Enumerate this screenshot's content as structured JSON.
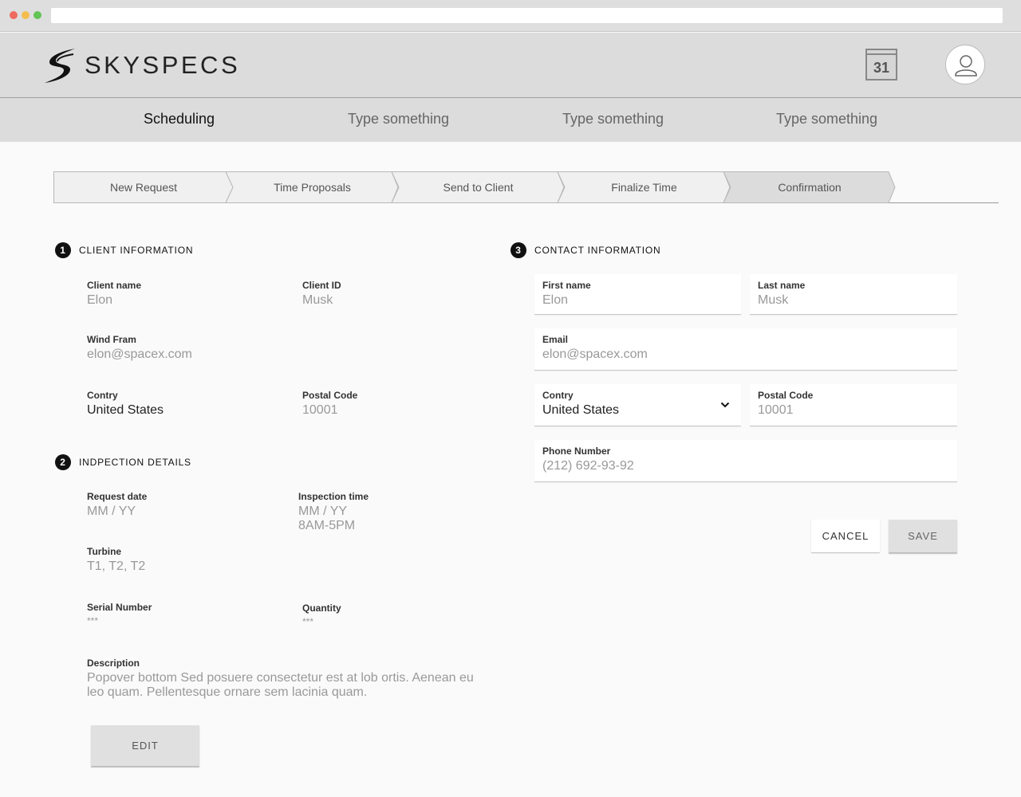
{
  "app": {
    "brand": "SKYSPECS"
  },
  "header": {
    "calendar_day": "31",
    "nav": [
      {
        "label": "Scheduling",
        "active": true
      },
      {
        "label": "Type something",
        "active": false
      },
      {
        "label": "Type something",
        "active": false
      },
      {
        "label": "Type something",
        "active": false
      }
    ]
  },
  "stepper": {
    "steps": [
      "New Request",
      "Time Proposals",
      "Send to Client",
      "Finalize Time",
      "Confirmation"
    ],
    "current_index": 4
  },
  "client_info": {
    "number": "1",
    "title": "CLIENT INFORMATION",
    "client_name_label": "Client name",
    "client_name_value": "Elon",
    "client_id_label": "Client ID",
    "client_id_value": "Musk",
    "wind_farm_label": "Wind Fram",
    "wind_farm_value": "elon@spacex.com",
    "country_label": "Contry",
    "country_value": "United States",
    "postal_label": "Postal Code",
    "postal_value": "10001"
  },
  "inspection": {
    "number": "2",
    "title": "INDPECTION DETAILS",
    "request_date_label": "Request date",
    "request_date_value": "MM / YY",
    "inspection_time_label": "Inspection time",
    "inspection_time_value1": "MM / YY",
    "inspection_time_value2": "8AM-5PM",
    "turbine_label": "Turbine",
    "turbine_value": "T1, T2, T2",
    "serial_label": "Serial Number",
    "serial_value": "***",
    "quantity_label": "Quantity",
    "quantity_value": "***",
    "description_label": "Description",
    "description_line1": "Popover bottom Sed posuere consectetur est at lob ortis. Aenean eu",
    "description_line2": "leo quam. Pellentesque ornare sem lacinia quam.",
    "edit_label": "EDIT"
  },
  "contact": {
    "number": "3",
    "title": "CONTACT INFORMATION",
    "first_name_label": "First name",
    "first_name_value": "Elon",
    "last_name_label": "Last name",
    "last_name_value": "Musk",
    "email_label": "Email",
    "email_value": "elon@spacex.com",
    "country_label": "Contry",
    "country_value": "United States",
    "postal_label": "Postal Code",
    "postal_value": "10001",
    "phone_label": "Phone Number",
    "phone_value": "(212) 692-93-92",
    "cancel_label": "CANCEL",
    "save_label": "SAVE"
  }
}
